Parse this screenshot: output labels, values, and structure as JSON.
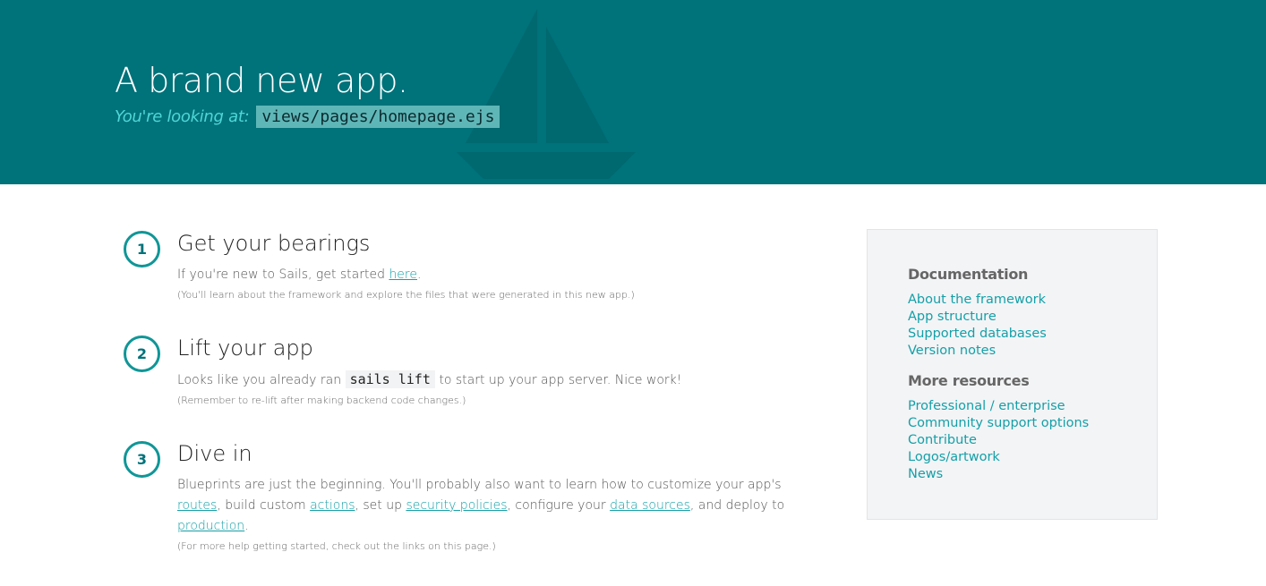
{
  "header": {
    "title": "A brand new app.",
    "sub_label": "You're looking at:",
    "sub_path": "views/pages/homepage.ejs"
  },
  "steps": [
    {
      "number": "1",
      "title": "Get your bearings",
      "text_before": "If you're new to Sails, get started ",
      "link": "here",
      "text_after": ".",
      "note": "(You'll learn about the framework and explore the files that were generated in this new app.)"
    },
    {
      "number": "2",
      "title": "Lift your app",
      "text_before": "Looks like you already ran ",
      "code": "sails lift",
      "text_after": " to start up your app server. Nice work!",
      "note": "(Remember to re-lift after making backend code changes.)"
    },
    {
      "number": "3",
      "title": "Dive in",
      "text_1": "Blueprints are just the beginning. You'll probably also want to learn how to customize your app's ",
      "link_routes": "routes",
      "text_2": ", build custom ",
      "link_actions": "actions",
      "text_3": ", set up ",
      "link_security": "security policies",
      "text_4": ", configure your ",
      "link_datasources": "data sources",
      "text_5": ", and deploy to ",
      "link_production": "production",
      "text_6": ".",
      "note": "(For more help getting started, check out the links on this page.)"
    }
  ],
  "sidebar": {
    "documentation_heading": "Documentation",
    "documentation_links": [
      "About the framework",
      "App structure",
      "Supported databases",
      "Version notes"
    ],
    "resources_heading": "More resources",
    "resources_links": [
      "Professional / enterprise",
      "Community support options",
      "Contribute",
      "Logos/artwork",
      "News"
    ]
  },
  "colors": {
    "header_bg": "#00727a",
    "accent": "#14a0a8",
    "circle": "#109697"
  }
}
